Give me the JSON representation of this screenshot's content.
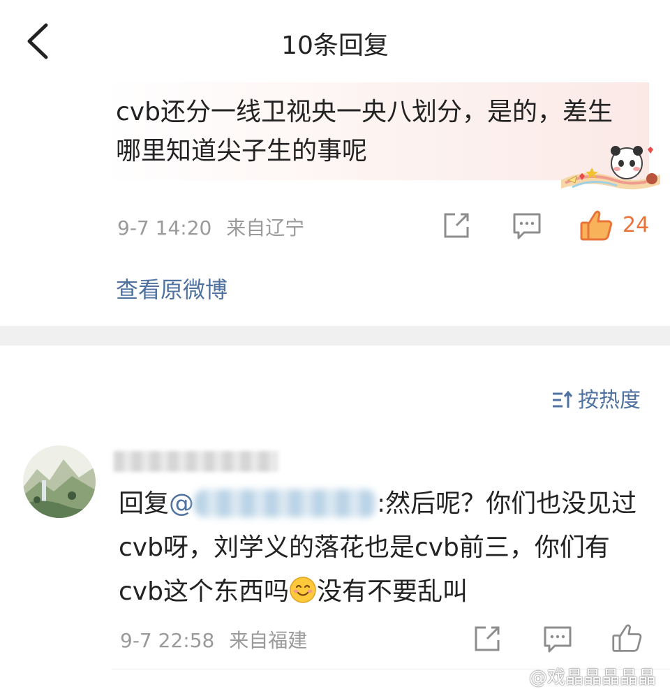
{
  "header": {
    "title": "10条回复"
  },
  "original_post": {
    "text": "cvb还分一线卫视央一央八划分，是的，差生哪里知道尖子生的事呢",
    "date": "9-7 14:20",
    "location": "来自辽宁",
    "like_count": "24",
    "view_original_label": "查看原微博"
  },
  "sort": {
    "label": "按热度"
  },
  "reply": {
    "prefix": "回复",
    "at": "@",
    "text_after_mention": ":然后呢？你们也没见过cvb呀，刘学义的落花也是cvb前三，你们有cvb这个东西吗",
    "text_after_emoji": "没有不要乱叫",
    "date": "9-7 22:58",
    "location": "来自福建"
  },
  "watermark": "@戏晶晶晶晶晶",
  "colors": {
    "link": "#4f72a0",
    "like_active": "#e9743a",
    "meta": "#9a9a9a"
  },
  "icons": {
    "back": "chevron-left-icon",
    "forward": "share-box-icon",
    "comment": "comment-bubble-icon",
    "like": "thumbs-up-icon",
    "sort": "sort-icon",
    "emoji": "smiley-emoji"
  }
}
